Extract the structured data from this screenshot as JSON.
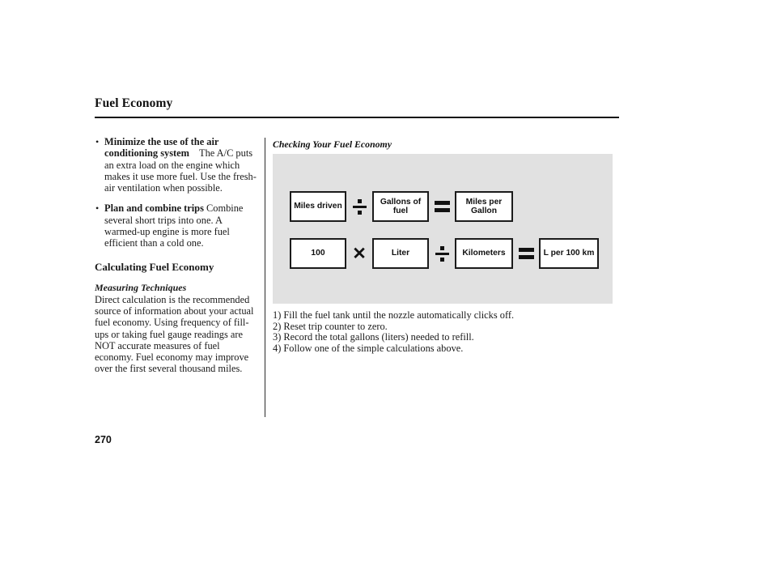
{
  "page": {
    "title": "Fuel Economy",
    "number": "270"
  },
  "left_column": {
    "bullets": [
      {
        "bullet_glyph": "•",
        "lead": "Minimize the use of the air conditioning system",
        "body": "The A/C puts an extra load on the engine which makes it use more fuel. Use the fresh-air ventilation when possible."
      },
      {
        "bullet_glyph": "•",
        "lead": "Plan and combine trips",
        "body": "Combine several short trips into one. A warmed-up engine is more fuel efficient than a cold one."
      }
    ],
    "section_heading": "Calculating Fuel Economy",
    "subsection_heading": "Measuring Techniques",
    "subsection_body": "Direct calculation is the recommended source of information about your actual fuel economy. Using frequency of fill-ups or taking fuel gauge readings are NOT accurate measures of fuel economy. Fuel economy may improve over the first several thousand miles."
  },
  "right_column": {
    "figure_caption": "Checking Your Fuel Economy",
    "panel_background": "#e1e1e1",
    "formulas": [
      {
        "name": "imperial",
        "terms": [
          "Miles driven",
          "Gallons of fuel",
          "Miles per Gallon"
        ],
        "operators": [
          "divide-icon",
          "equals-icon"
        ]
      },
      {
        "name": "metric",
        "terms": [
          "100",
          "Liter",
          "Kilometers",
          "L per 100 km"
        ],
        "operators": [
          "multiply-icon",
          "divide-icon",
          "equals-icon"
        ]
      }
    ],
    "steps": [
      "1) Fill the fuel tank until the nozzle automatically clicks off.",
      "2) Reset trip counter to zero.",
      "3) Record the total gallons (liters) needed to refill.",
      "4) Follow one of the simple calculations above."
    ]
  }
}
